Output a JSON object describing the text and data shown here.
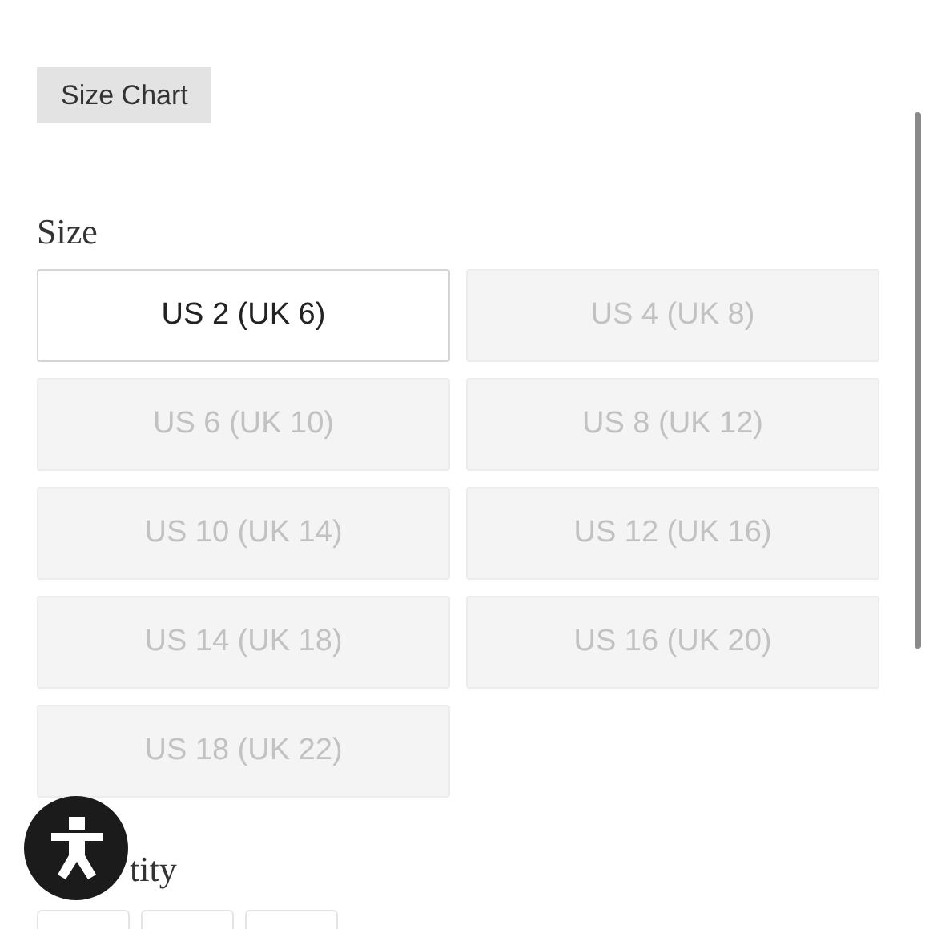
{
  "size_chart_button": "Size Chart",
  "size_heading": "Size",
  "sizes": [
    {
      "label": "US 2 (UK 6)",
      "available": true
    },
    {
      "label": "US 4 (UK 8)",
      "available": false
    },
    {
      "label": "US 6 (UK 10)",
      "available": false
    },
    {
      "label": "US 8 (UK 12)",
      "available": false
    },
    {
      "label": "US 10 (UK 14)",
      "available": false
    },
    {
      "label": "US 12 (UK 16)",
      "available": false
    },
    {
      "label": "US 14 (UK 18)",
      "available": false
    },
    {
      "label": "US 16 (UK 20)",
      "available": false
    },
    {
      "label": "US 18 (UK 22)",
      "available": false
    }
  ],
  "quantity_heading": "tity"
}
